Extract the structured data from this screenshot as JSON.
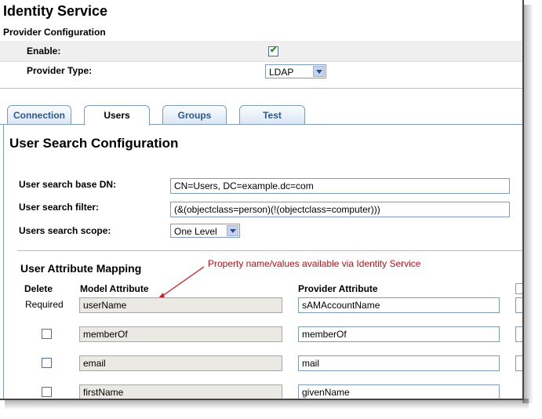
{
  "header": {
    "title": "Identity Service",
    "subtitle": "Provider Configuration"
  },
  "provider": {
    "enable_label": "Enable:",
    "enable_checked": true,
    "type_label": "Provider Type:",
    "type_value": "LDAP"
  },
  "tabs": [
    {
      "label": "Connection",
      "active": false
    },
    {
      "label": "Users",
      "active": true
    },
    {
      "label": "Groups",
      "active": false
    },
    {
      "label": "Test",
      "active": false
    }
  ],
  "users": {
    "section_title": "User Search Configuration",
    "base_dn_label": "User search base DN:",
    "base_dn_value": "CN=Users, DC=example.dc=com",
    "filter_label": "User search filter:",
    "filter_value": "(&(objectclass=person)(!(objectclass=computer)))",
    "scope_label": "Users search scope:",
    "scope_value": "One Level"
  },
  "mapping": {
    "title": "User Attribute Mapping",
    "annotation": "Property name/values  available via Identity Service",
    "headers": {
      "delete": "Delete",
      "model": "Model Attribute",
      "provider": "Provider Attribute"
    },
    "rows": [
      {
        "delete": "Required",
        "model": "userName",
        "provider": "sAMAccountName"
      },
      {
        "delete": "",
        "model": "memberOf",
        "provider": "memberOf"
      },
      {
        "delete": "",
        "model": "email",
        "provider": "mail"
      },
      {
        "delete": "",
        "model": "firstName",
        "provider": "givenName"
      }
    ]
  },
  "colors": {
    "annotation": "#b0141a",
    "tab_text": "#2a5a90",
    "check": "#1d8a1d"
  }
}
